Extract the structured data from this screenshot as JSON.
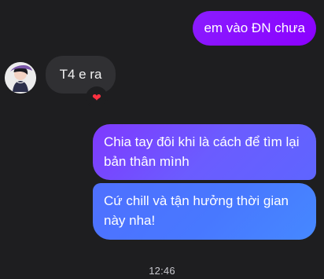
{
  "messages": {
    "outgoing_1": "em vào ĐN chưa",
    "incoming_1": "T4 e ra",
    "outgoing_2": "Chia tay đôi khi là cách để tìm lại bản thân mình",
    "outgoing_3": "Cứ chill và tận hưởng thời gian này nha!",
    "reaction": "❤"
  },
  "time": "12:46",
  "colors": {
    "background": "#1e1e20",
    "incoming_bubble": "#303033",
    "outgoing_purple": "#8b00ff",
    "outgoing_gradient_start": "#7f39ff",
    "outgoing_gradient_end": "#4688ff",
    "reaction": "#ff3040"
  }
}
